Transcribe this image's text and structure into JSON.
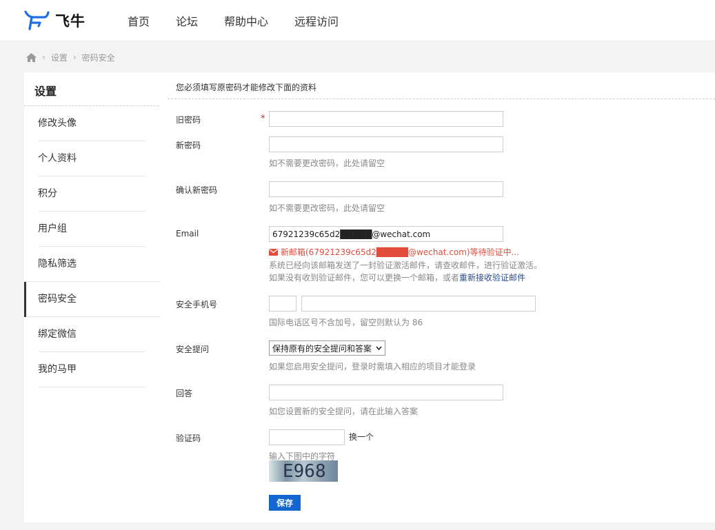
{
  "header": {
    "logo_text": "飞牛",
    "nav": [
      {
        "label": "首页"
      },
      {
        "label": "论坛"
      },
      {
        "label": "帮助中心"
      },
      {
        "label": "远程访问"
      }
    ]
  },
  "breadcrumb": {
    "items": [
      "设置",
      "密码安全"
    ]
  },
  "sidebar": {
    "title": "设置",
    "items": [
      {
        "label": "修改头像"
      },
      {
        "label": "个人资料"
      },
      {
        "label": "积分"
      },
      {
        "label": "用户组"
      },
      {
        "label": "隐私筛选"
      },
      {
        "label": "密码安全"
      },
      {
        "label": "绑定微信"
      },
      {
        "label": "我的马甲"
      }
    ],
    "active": "密码安全"
  },
  "form": {
    "notice": "您必须填写原密码才能修改下面的资料",
    "old_password": {
      "label": "旧密码",
      "required_mark": "*",
      "value": ""
    },
    "new_password": {
      "label": "新密码",
      "value": "",
      "hint": "如不需要更改密码，此处请留空"
    },
    "confirm_password": {
      "label": "确认新密码",
      "value": "",
      "hint": "如不需要更改密码，此处请留空"
    },
    "email": {
      "label": "Email",
      "value": "67921239c65d2█████@wechat.com",
      "pending": "新邮箱(67921239c65d2█████@wechat.com)等待验证中...",
      "hint1": "系统已经向该邮箱发送了一封验证激活邮件，请查收邮件，进行验证激活。",
      "hint2_prefix": "如果没有收到验证邮件，您可以更换一个邮箱，或者",
      "resend_link": "重新接收验证邮件"
    },
    "phone": {
      "label": "安全手机号",
      "code_value": "",
      "number_value": "",
      "hint": "国际电话区号不含加号，留空则默认为 86"
    },
    "security_question": {
      "label": "安全提问",
      "selected": "保持原有的安全提问和答案",
      "hint": "如果您启用安全提问，登录时需填入相应的项目才能登录"
    },
    "answer": {
      "label": "回答",
      "value": "",
      "hint": "如您设置新的安全提问，请在此输入答案"
    },
    "captcha": {
      "label": "验证码",
      "value": "",
      "change_label": "换一个",
      "hint": "输入下图中的字符",
      "image_text": "E968"
    },
    "save_label": "保存"
  },
  "colors": {
    "primary": "#1366cf",
    "warning": "#e24c3c",
    "link": "#2a4d8f",
    "logo_blue": "#1f6fe0"
  }
}
